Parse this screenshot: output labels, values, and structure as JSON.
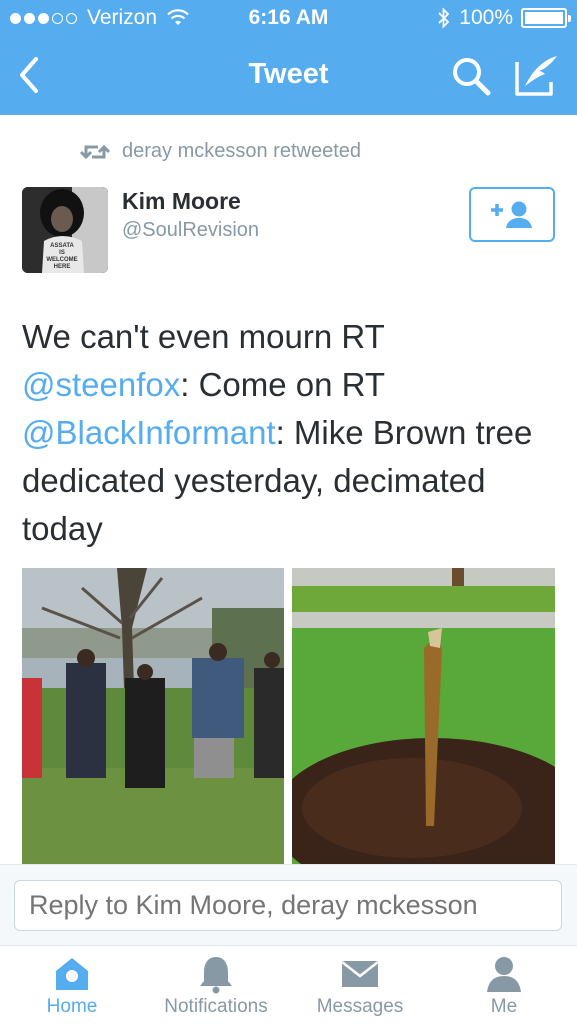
{
  "status_bar": {
    "carrier": "Verizon",
    "time": "6:16 AM",
    "battery": "100%"
  },
  "nav": {
    "title": "Tweet"
  },
  "retweet_context": "deray mckesson retweeted",
  "tweet": {
    "author_name": "Kim Moore",
    "author_handle": "@SoulRevision",
    "text_parts": {
      "p1": "We can't even mourn RT ",
      "m1": "@steenfox",
      "p2": ": Come on RT ",
      "m2": "@BlackInformant",
      "p3": ": Mike Brown tree dedicated yesterday, decimated today"
    },
    "avatar_shirt_text": [
      "ASSATA",
      "IS",
      "WELCOME",
      "HERE"
    ]
  },
  "reply": {
    "placeholder": "Reply to Kim Moore, deray mckesson"
  },
  "tabs": [
    {
      "label": "Home",
      "icon": "home-icon",
      "active": true
    },
    {
      "label": "Notifications",
      "icon": "bell-icon",
      "active": false
    },
    {
      "label": "Messages",
      "icon": "envelope-icon",
      "active": false
    },
    {
      "label": "Me",
      "icon": "person-icon",
      "active": false
    }
  ],
  "colors": {
    "accent": "#55acee",
    "text": "#292f33",
    "muted": "#8899a6"
  }
}
